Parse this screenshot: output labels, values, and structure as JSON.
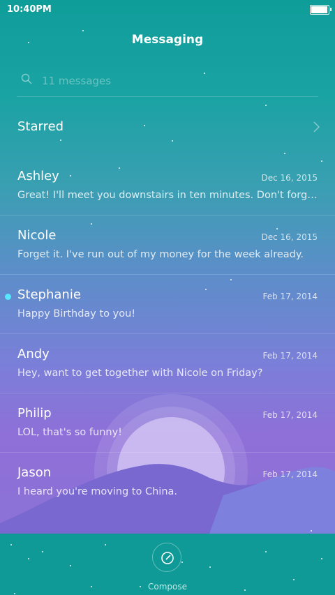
{
  "status_bar": {
    "time": "10:40PM",
    "battery_level": 0.95
  },
  "header": {
    "title": "Messaging"
  },
  "search": {
    "placeholder": "11 messages"
  },
  "starred": {
    "label": "Starred"
  },
  "conversations": [
    {
      "name": "Ashley",
      "date": "Dec 16, 2015",
      "snippet": "Great! I'll meet you downstairs in ten minutes. Don't forget to…",
      "unread": false
    },
    {
      "name": "Nicole",
      "date": "Dec 16, 2015",
      "snippet": "Forget it. I've run out of my money for the week already.",
      "unread": false
    },
    {
      "name": "Stephanie",
      "date": "Feb 17, 2014",
      "snippet": "Happy Birthday to you!",
      "unread": true
    },
    {
      "name": "Andy",
      "date": "Feb 17, 2014",
      "snippet": "Hey, want to get together with Nicole on Friday?",
      "unread": false
    },
    {
      "name": "Philip",
      "date": "Feb 17, 2014",
      "snippet": "LOL, that's so funny!",
      "unread": false
    },
    {
      "name": "Jason",
      "date": "Feb 17, 2014",
      "snippet": "I heard you're moving to China.",
      "unread": false
    }
  ],
  "compose": {
    "label": "Compose"
  },
  "colors": {
    "unread_dot": "#56e7ff",
    "bottom_bar": "#0f9a97"
  }
}
